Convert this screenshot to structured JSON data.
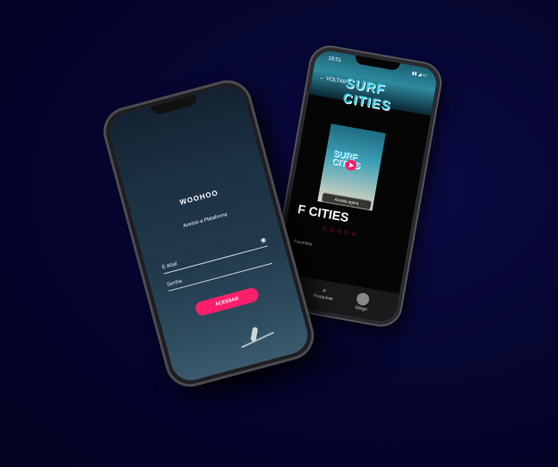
{
  "colors": {
    "background": "#050530",
    "accent": "#ff1f6b",
    "cyan": "#3ec6e0"
  },
  "phone_right": {
    "time": "18:51",
    "back_label": "VOLTAR",
    "hero_title": "SURF CITIES",
    "poster_title": "SURF CITIES",
    "watch_button": "Assista agora",
    "big_title": "F CITIES",
    "stars": "☆☆☆☆☆",
    "favorites_label": "Favoritos",
    "nav": [
      {
        "label": "",
        "icon": "screen-icon"
      },
      {
        "label": "Pesquisar",
        "icon": "search-icon"
      },
      {
        "label": "Diego",
        "icon": "avatar"
      }
    ]
  },
  "phone_left": {
    "logo": "WOOHOO",
    "subtitle": "Acesso a Plataforma",
    "email_label": "E-Mail",
    "password_label": "Senha",
    "login_button": "ACESSAR"
  }
}
